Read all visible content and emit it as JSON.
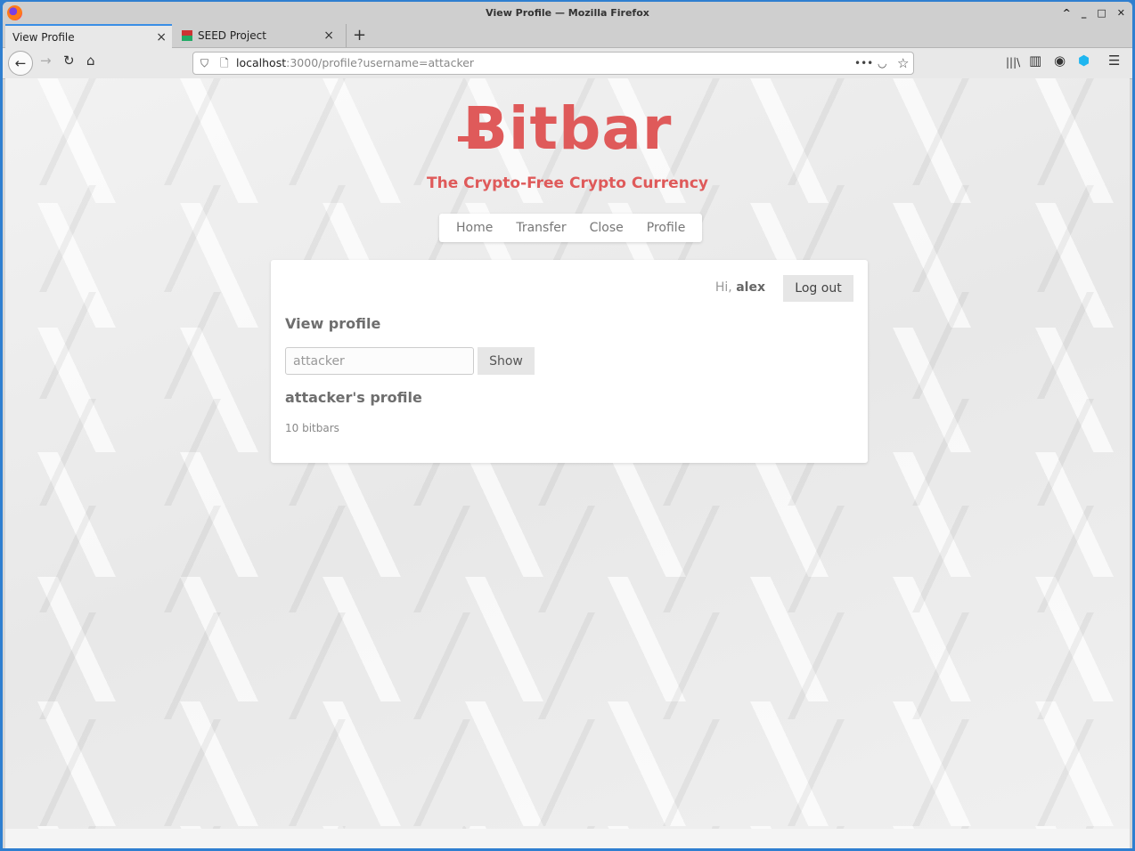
{
  "window": {
    "title": "View Profile — Mozilla Firefox",
    "controls": [
      "^",
      "_",
      "□",
      "✕"
    ]
  },
  "tabs": [
    {
      "label": "View Profile",
      "close": "×"
    },
    {
      "label": "SEED Project",
      "close": "×"
    }
  ],
  "new_tab": "+",
  "nav": {
    "back": "←",
    "forward": "→",
    "reload": "↻",
    "home": "⌂",
    "url_host": "localhost",
    "url_rest": ":3000/profile?username=attacker",
    "more": "•••",
    "pocket": "◡",
    "star": "☆",
    "library": "|||\\",
    "sidebar": "▥",
    "account": "◉",
    "extension": "⬢",
    "menu": "☰"
  },
  "page": {
    "brand": "Bitbar",
    "tagline": "The Crypto-Free Crypto Currency",
    "menu": [
      "Home",
      "Transfer",
      "Close",
      "Profile"
    ],
    "greeting": "Hi,",
    "user": "alex",
    "logout": "Log out",
    "view_title": "View profile",
    "username_value": "attacker",
    "show": "Show",
    "profile_title": "attacker's profile",
    "balance": "10 bitbars"
  },
  "colors": {
    "brand": "#df5a5a",
    "tab_accent": "#3a8ee6"
  }
}
